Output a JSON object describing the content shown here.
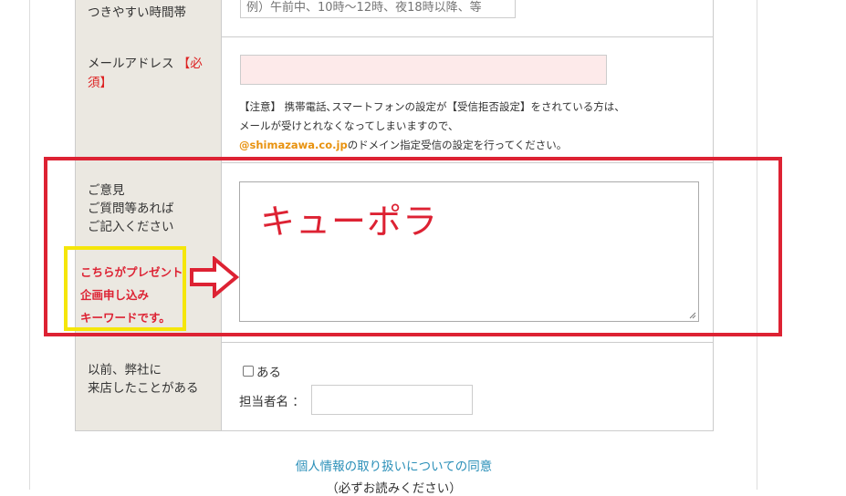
{
  "time_row": {
    "label": "つきやすい時間帯",
    "placeholder": "例）午前中、10時～12時、夜18時以降、等"
  },
  "email_row": {
    "label": "メールアドレス",
    "required": "【必須】",
    "note_line1": "【注意】 携帯電話､スマートフォンの設定が【受信拒否設定】をされている方は、",
    "note_line2": "メールが受けとれなくなってしまいますので、",
    "note_domain": "@shimazawa.co.jp",
    "note_line3_rest": "のドメイン指定受信の設定を行ってください。",
    "input_color": "#fdeaea"
  },
  "comment_row": {
    "label_line1": "ご意見",
    "label_line2": "ご質問等あれば",
    "label_line3": "ご記入ください",
    "textarea_value": "キューポラ"
  },
  "annotation": {
    "line1": "こちらがプレゼント",
    "line2": "企画申し込み",
    "line3": "キーワードです。",
    "red_color": "#dd2233",
    "yellow_color": "#f5e60a",
    "arrow_icon": "right-arrow-outline-icon"
  },
  "visit_row": {
    "label_line1": "以前、弊社に",
    "label_line2": "来店したことがある",
    "checkbox_label": "ある",
    "checkbox_checked": false,
    "staff_label": "担当者名 ："
  },
  "footer": {
    "privacy_link": "個人情報の取り扱いについての同意",
    "privacy_note": "（必ずお読みください）"
  }
}
